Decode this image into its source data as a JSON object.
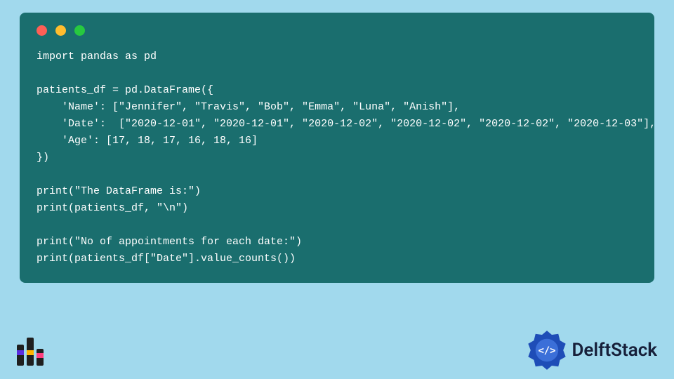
{
  "code": {
    "lines": [
      "import pandas as pd",
      "",
      "patients_df = pd.DataFrame({",
      "    'Name': [\"Jennifer\", \"Travis\", \"Bob\", \"Emma\", \"Luna\", \"Anish\"],",
      "    'Date':  [\"2020-12-01\", \"2020-12-01\", \"2020-12-02\", \"2020-12-02\", \"2020-12-02\", \"2020-12-03\"],",
      "    'Age': [17, 18, 17, 16, 18, 16]",
      "})",
      "",
      "print(\"The DataFrame is:\")",
      "print(patients_df, \"\\n\")",
      "",
      "print(\"No of appointments for each date:\")",
      "print(patients_df[\"Date\"].value_counts())"
    ]
  },
  "brand": {
    "name": "DelftStack"
  }
}
